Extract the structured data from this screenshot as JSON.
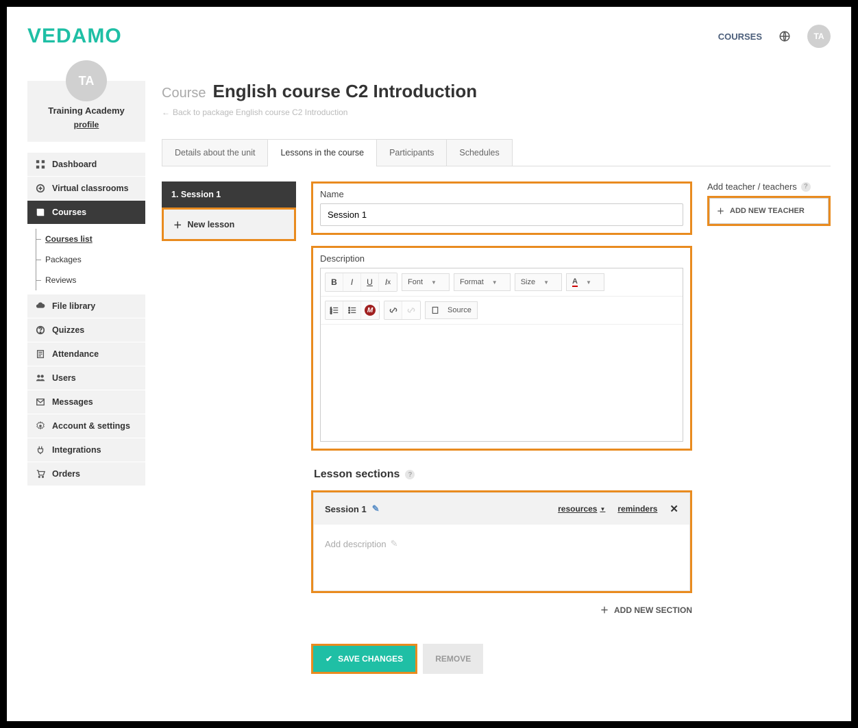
{
  "header": {
    "logo": "VEDAMO",
    "courses_link": "COURSES",
    "avatar_initials": "TA"
  },
  "profile": {
    "avatar_initials": "TA",
    "org_name": "Training Academy",
    "profile_link": "profile"
  },
  "nav": {
    "dashboard": "Dashboard",
    "virtual_classrooms": "Virtual classrooms",
    "courses": "Courses",
    "courses_sub": {
      "list": "Courses list",
      "packages": "Packages",
      "reviews": "Reviews"
    },
    "file_library": "File library",
    "quizzes": "Quizzes",
    "attendance": "Attendance",
    "users": "Users",
    "messages": "Messages",
    "account": "Account & settings",
    "integrations": "Integrations",
    "orders": "Orders"
  },
  "page": {
    "prefix": "Course",
    "title": "English course C2 Introduction",
    "back": "Back to package English course C2 Introduction"
  },
  "tabs": {
    "details": "Details about the unit",
    "lessons": "Lessons in the course",
    "participants": "Participants",
    "schedules": "Schedules"
  },
  "lessons": {
    "item1": "1. Session 1",
    "new": "New lesson"
  },
  "form": {
    "name_label": "Name",
    "name_value": "Session 1",
    "desc_label": "Description",
    "font_sel": "Font",
    "format_sel": "Format",
    "size_sel": "Size",
    "source_btn": "Source"
  },
  "teacher": {
    "label": "Add teacher / teachers",
    "button": "ADD NEW TEACHER"
  },
  "sections": {
    "heading": "Lesson sections",
    "item_name": "Session 1",
    "resources": "resources",
    "reminders": "reminders",
    "add_desc": "Add description",
    "add_new": "ADD NEW SECTION"
  },
  "actions": {
    "save": "SAVE CHANGES",
    "remove": "REMOVE"
  }
}
